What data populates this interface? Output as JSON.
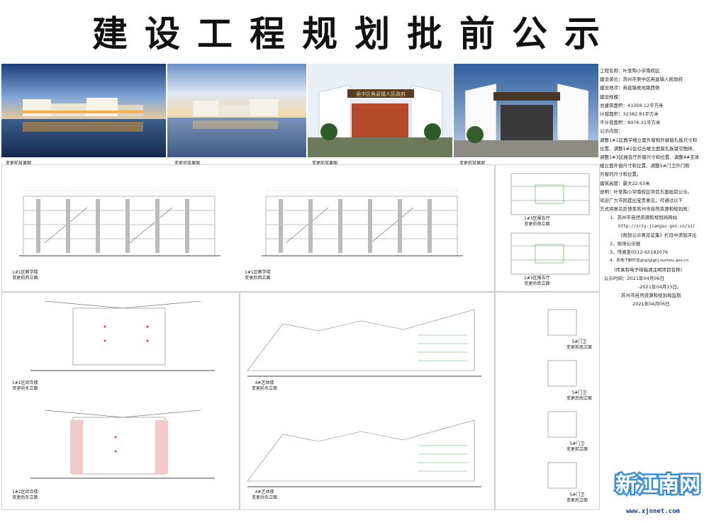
{
  "title": "建设工程规划批前公示",
  "photos": [
    {
      "caption": "变更前效果图"
    },
    {
      "caption": "变更后效果图"
    },
    {
      "caption": "变更前效果图"
    },
    {
      "caption": "变更后效果图"
    }
  ],
  "drawings": {
    "d1a": [
      "1#1区教学楼",
      "变更前西立面"
    ],
    "d1b": [
      "1#1区教学楼",
      "变更后西立面"
    ],
    "d3a": [
      "1#3区报告厅",
      "变更前南立面"
    ],
    "d3b": [
      "1#3区报告厅",
      "变更后南立面"
    ],
    "d2a": [
      "1#2区综合楼",
      "变更前东立面"
    ],
    "d2b": [
      "1#2区综合楼",
      "变更后东立面"
    ],
    "d4a": [
      "4#艺体楼",
      "变更前东立面"
    ],
    "d4b": [
      "4#艺体楼",
      "变更后东立面"
    ],
    "d5a": [
      "5#门卫",
      "变更前南立面"
    ],
    "d5b": [
      "5#门卫",
      "变更后南立面"
    ],
    "d5c": [
      "5#门卫",
      "变更前立面"
    ],
    "d5d": [
      "5#门卫",
      "变更后立面"
    ],
    "facade_sign": "吴中区角直镇人民政府"
  },
  "notice": {
    "project_name": "工程名称：叶圣陶小学南校区",
    "unit": "建设单位：苏州市吴中区甪直镇人民政府",
    "location": "建设地点：甪直镇吴淞路西侧",
    "scale_title": "建设规模：",
    "total_area": "总建筑面积：41359.12平方米",
    "capacity_area": "计容面积：32382.81平方米",
    "non_capacity_area": "不计容面积：8976.31平方米",
    "content_title": "公示内容：",
    "content_1": "调整1#1区教学楼立面外窗和外廊窗孔板尺寸和",
    "content_2": "位置、调整1#2区综合楼立面窗孔板镂空图样、",
    "content_3": "调整1#3区报告厅外窗尺寸和位置、调整4#艺体",
    "content_4": "楼立面外窗尺寸和位置、调整5#门卫外门和",
    "content_5": "外窗的尺寸和位置。",
    "height": "建筑高度：最大22.63米",
    "note_1": "说明：叶圣陶小学南校区项目方案批前公示。",
    "note_2": "欢迎广大市民提出宝贵意见，可通过以下",
    "note_3": "方式将意见反馈至苏州市自然资源和规划局：",
    "way_1": "1、苏州市自然资源和规划局网站",
    "way_1_url": "http://zrzy.jiangsu.gov.cn/sz/",
    "way_1_desc": "《规划公示意见征集》栏目中添加评论",
    "way_2": "2、现场公示展",
    "way_3": "3、传真至0512-65182076",
    "way_4": "4、发电子邮件至ghgl@ghj.suzhou.gov.cn",
    "way_4_note": "(传真和电子邮箱请注明项目名称)",
    "period_1": "公示时间：2021年04月06日",
    "period_2": "-2021年04月15日。",
    "org": "苏州市自然资源和规划局监制",
    "date": "2021年04月06日"
  },
  "watermark": {
    "logo_text": "新江南网",
    "url": "www.xjnnet.com"
  }
}
